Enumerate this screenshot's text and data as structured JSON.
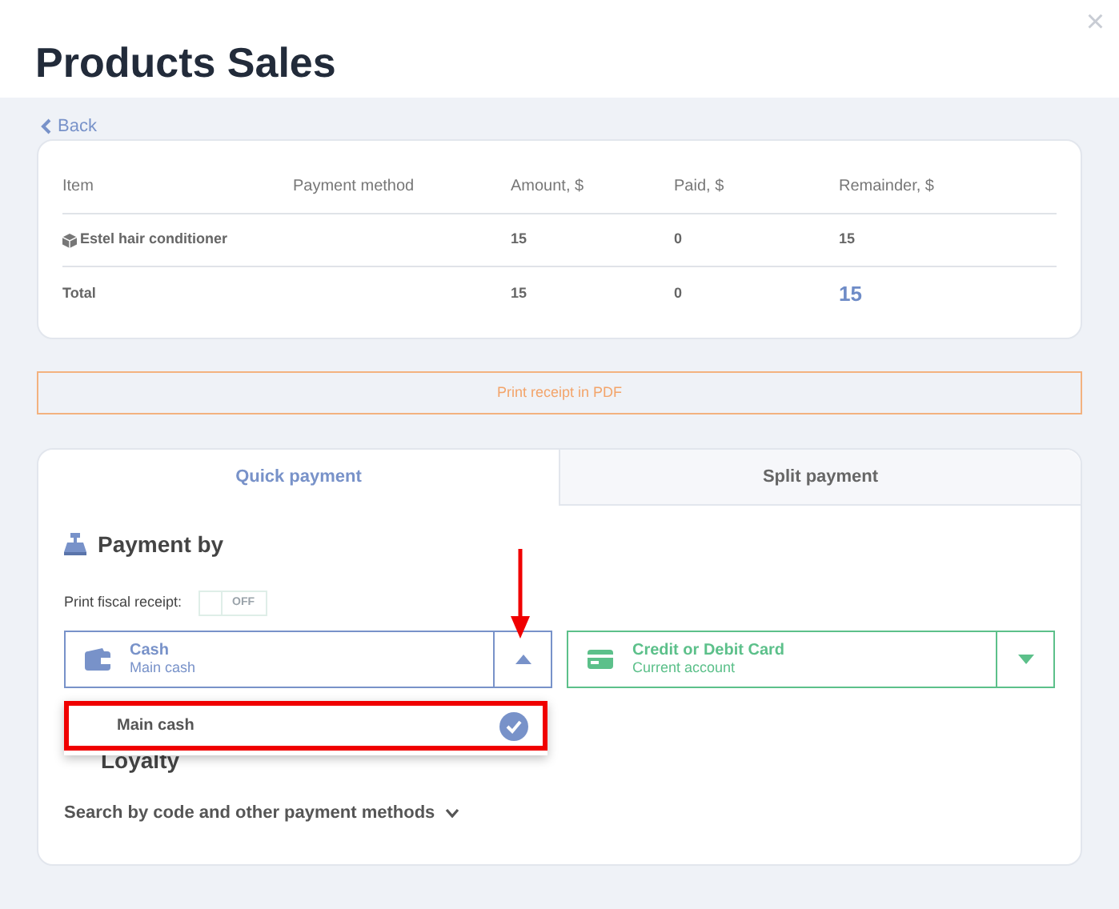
{
  "title": "Products Sales",
  "close": "×",
  "back": "Back",
  "table": {
    "columns": [
      "Item",
      "Payment method",
      "Amount, $",
      "Paid, $",
      "Remainder, $"
    ],
    "rows": [
      {
        "kind": "item",
        "cells": [
          "Estel hair conditioner",
          "",
          "15",
          "0",
          "15"
        ]
      },
      {
        "kind": "total",
        "cells": [
          "Total",
          "",
          "15",
          "0",
          "15"
        ]
      }
    ]
  },
  "print_button": "Print receipt in PDF",
  "tabs": [
    {
      "label": "Quick payment",
      "selected": true
    },
    {
      "label": "Split payment",
      "selected": false
    }
  ],
  "payment_heading": "Payment by",
  "fiscal": {
    "label": "Print fiscal receipt:",
    "on": false,
    "state_text": "OFF"
  },
  "methods": [
    {
      "kind": "cash",
      "title": "Cash",
      "subtitle": "Main cash",
      "expanded": true,
      "color": "#7892c9"
    },
    {
      "kind": "card",
      "title": "Credit or Debit Card",
      "subtitle": "Current account",
      "expanded": false,
      "color": "#5cc08a"
    }
  ],
  "dropdown_options": [
    {
      "label": "Main cash",
      "selected": true
    }
  ],
  "loyalty": "Loyalty",
  "search_link": "Search by code and other payment methods"
}
